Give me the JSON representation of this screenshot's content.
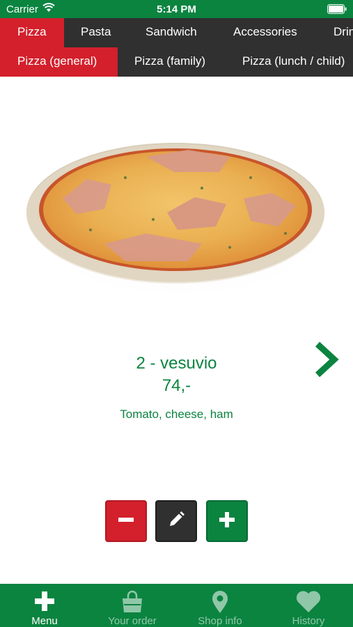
{
  "status_bar": {
    "carrier": "Carrier",
    "time": "5:14 PM"
  },
  "categories": {
    "selected": "Pizza",
    "items": [
      "Pizza",
      "Pasta",
      "Sandwich",
      "Accessories",
      "Drinks"
    ]
  },
  "subcategories": {
    "selected": "Pizza (general)",
    "items": [
      "Pizza (general)",
      "Pizza (family)",
      "Pizza (lunch / child)"
    ]
  },
  "product": {
    "image_icon": "pizza-photo",
    "title": "2 - vesuvio",
    "price": "74,-",
    "description": "Tomato, cheese, ham"
  },
  "actions": {
    "minus_icon": "minus-icon",
    "edit_icon": "pencil-icon",
    "plus_icon": "plus-icon"
  },
  "tab_bar": {
    "active": "Menu",
    "items": [
      {
        "label": "Menu",
        "icon": "plus-icon"
      },
      {
        "label": "Your order",
        "icon": "shopping-bag-icon"
      },
      {
        "label": "Shop info",
        "icon": "location-pin-icon"
      },
      {
        "label": "History",
        "icon": "heart-icon"
      }
    ]
  },
  "colors": {
    "brand_green": "#0b8440",
    "accent_red": "#d3202c",
    "dark_bar": "#303030"
  }
}
